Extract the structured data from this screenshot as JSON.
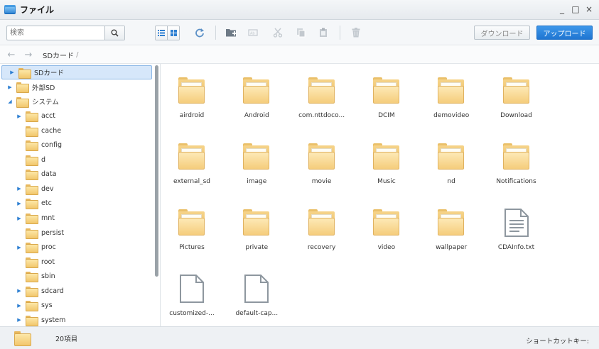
{
  "window": {
    "title": "ファイル",
    "controls": [
      "_",
      "□",
      "×"
    ]
  },
  "toolbar": {
    "search_placeholder": "検索",
    "download_label": "ダウンロード",
    "upload_label": "アップロード",
    "accent_color": "#1f75d1",
    "icons": [
      "list-view-icon",
      "grid-view-icon",
      "refresh-icon",
      "new-folder-icon",
      "rename-icon",
      "cut-icon",
      "copy-icon",
      "paste-icon",
      "delete-icon"
    ]
  },
  "navbar": {
    "back": "←",
    "forward": "→",
    "breadcrumb": "SDカード",
    "separator": "/"
  },
  "tree": [
    {
      "label": "SDカード",
      "expandable": true,
      "expanded": false,
      "selected": true
    },
    {
      "label": "外部SD",
      "expandable": true,
      "expanded": false
    },
    {
      "label": "システム",
      "expandable": true,
      "expanded": true
    },
    {
      "label": "acct",
      "expandable": true,
      "child": true
    },
    {
      "label": "cache",
      "expandable": false,
      "child": true
    },
    {
      "label": "config",
      "expandable": false,
      "child": true
    },
    {
      "label": "d",
      "expandable": false,
      "child": true
    },
    {
      "label": "data",
      "expandable": false,
      "child": true
    },
    {
      "label": "dev",
      "expandable": true,
      "child": true
    },
    {
      "label": "etc",
      "expandable": true,
      "child": true
    },
    {
      "label": "mnt",
      "expandable": true,
      "child": true
    },
    {
      "label": "persist",
      "expandable": false,
      "child": true
    },
    {
      "label": "proc",
      "expandable": true,
      "child": true
    },
    {
      "label": "root",
      "expandable": false,
      "child": true
    },
    {
      "label": "sbin",
      "expandable": false,
      "child": true
    },
    {
      "label": "sdcard",
      "expandable": true,
      "child": true
    },
    {
      "label": "sys",
      "expandable": true,
      "child": true
    },
    {
      "label": "system",
      "expandable": true,
      "child": true
    }
  ],
  "items": [
    {
      "name": "airdroid",
      "type": "folder"
    },
    {
      "name": "Android",
      "type": "folder"
    },
    {
      "name": "com.nttdoco...",
      "type": "folder"
    },
    {
      "name": "DCIM",
      "type": "folder"
    },
    {
      "name": "demovideo",
      "type": "folder"
    },
    {
      "name": "Download",
      "type": "folder"
    },
    {
      "name": "external_sd",
      "type": "folder"
    },
    {
      "name": "image",
      "type": "folder"
    },
    {
      "name": "movie",
      "type": "folder"
    },
    {
      "name": "Music",
      "type": "folder"
    },
    {
      "name": "nd",
      "type": "folder"
    },
    {
      "name": "Notifications",
      "type": "folder"
    },
    {
      "name": "Pictures",
      "type": "folder"
    },
    {
      "name": "private",
      "type": "folder"
    },
    {
      "name": "recovery",
      "type": "folder"
    },
    {
      "name": "video",
      "type": "folder"
    },
    {
      "name": "wallpaper",
      "type": "folder"
    },
    {
      "name": "CDAInfo.txt",
      "type": "text"
    },
    {
      "name": "customized-...",
      "type": "file"
    },
    {
      "name": "default-cap...",
      "type": "file"
    }
  ],
  "status": {
    "count": "20項目",
    "shortcut": "ショートカットキー:"
  }
}
